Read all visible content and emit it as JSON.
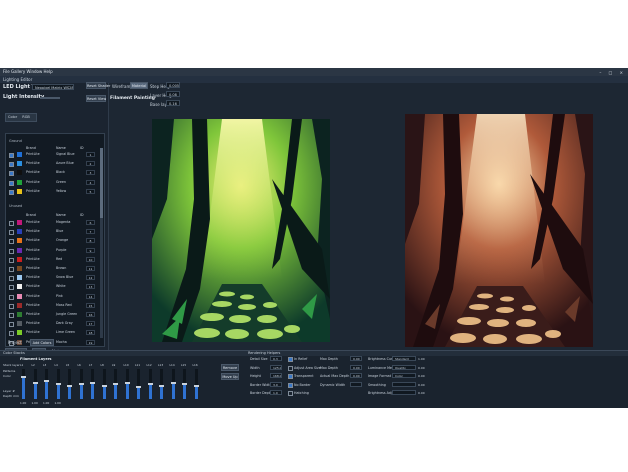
{
  "window": {
    "title": "File  Gallery  Window  Help",
    "controls": "– □ ×"
  },
  "menu": {
    "text": "Lighting Editor"
  },
  "left": {
    "led_type_label": "LED Light Type",
    "led_type_value": "Neopixel Matrix WS2812B",
    "intensity_label": "Light Intensity",
    "tabs": [
      "Color",
      "RGB"
    ],
    "group1": "Ground",
    "col_headers": [
      "Brand",
      "Name",
      "ID"
    ],
    "group1_rows": [
      {
        "brand": "PrintLite",
        "name": "Signal Blue",
        "val": "1",
        "color": "#1f6fd6",
        "checked": true
      },
      {
        "brand": "PrintLite",
        "name": "Azure Blue",
        "val": "2",
        "color": "#2b8fe0",
        "checked": true
      },
      {
        "brand": "PrintLite",
        "name": "Black",
        "val": "3",
        "color": "#101010",
        "checked": true
      },
      {
        "brand": "PrintLite",
        "name": "Green",
        "val": "4",
        "color": "#1fa33a",
        "checked": true
      },
      {
        "brand": "PrintLite",
        "name": "Yellow",
        "val": "5",
        "color": "#e8c21a",
        "checked": true
      }
    ],
    "group2": "Unused",
    "group2_rows": [
      {
        "brand": "PrintLite",
        "name": "Magenta",
        "val": "6",
        "color": "#c2187a"
      },
      {
        "brand": "PrintLite",
        "name": "Blue",
        "val": "7",
        "color": "#2940b8"
      },
      {
        "brand": "PrintLite",
        "name": "Orange",
        "val": "8",
        "color": "#e8731a"
      },
      {
        "brand": "PrintLite",
        "name": "Purple",
        "val": "9",
        "color": "#6a2ab0"
      },
      {
        "brand": "PrintLite",
        "name": "Red",
        "val": "10",
        "color": "#c81e1e"
      },
      {
        "brand": "PrintLite",
        "name": "Brown",
        "val": "11",
        "color": "#7a4a22"
      },
      {
        "brand": "PrintLite",
        "name": "Snow Blue",
        "val": "12",
        "color": "#9cc8f0"
      },
      {
        "brand": "PrintLite",
        "name": "White",
        "val": "13",
        "color": "#f0f0f0"
      },
      {
        "brand": "PrintLite",
        "name": "Pink",
        "val": "14",
        "color": "#e88ab4"
      },
      {
        "brand": "PrintLite",
        "name": "Moss Red",
        "val": "15",
        "color": "#9a2a2a"
      },
      {
        "brand": "PrintLite",
        "name": "Jungle Green",
        "val": "16",
        "color": "#2e7d32"
      },
      {
        "brand": "PrintLite",
        "name": "Dark Gray",
        "val": "17",
        "color": "#555c63"
      },
      {
        "brand": "PrintLite",
        "name": "Lime Green",
        "val": "18",
        "color": "#7ccc28"
      },
      {
        "brand": "PrintLite",
        "name": "Mocha",
        "val": "19",
        "color": "#6b4a3a"
      },
      {
        "brand": "PrintLite",
        "name": "Silver",
        "val": "20",
        "color": "#a8b0b8"
      }
    ],
    "new_btn": "New Element",
    "sort_btn": "Sort",
    "notes_label": "Notes",
    "project_label": "Project",
    "add_btn": "Add Colors"
  },
  "toolbar": {
    "reset_btn": "Reset Shader",
    "mode_label": "Wireframe",
    "mode_btn": "Material",
    "step_label": "Step Height",
    "step_value": "0.005",
    "layer_label": "Layer Height",
    "layer_value": "0.08",
    "base_label": "Base layer",
    "base_value": "0.16",
    "reset_view": "Reset View",
    "title": "Filament Painting"
  },
  "bottom_left": {
    "title": "Color Stacks",
    "header": "Filament Layers",
    "labels": [
      "Stack layer",
      "Patterns",
      "Color"
    ],
    "footer_labels": [
      "Layer #",
      "Depth mm"
    ],
    "columns": [
      "L1",
      "L2",
      "L3",
      "L4",
      "L5",
      "L6",
      "L7",
      "L8",
      "L9",
      "L10",
      "L11",
      "L12",
      "L13",
      "L14",
      "L15",
      "L16"
    ],
    "levels": [
      0.75,
      0.55,
      0.6,
      0.5,
      0.45,
      0.5,
      0.55,
      0.45,
      0.5,
      0.55,
      0.4,
      0.5,
      0.45,
      0.55,
      0.5,
      0.45
    ],
    "bottom_values": [
      "1.00",
      "1.00",
      "1.00",
      "1.00",
      "",
      "",
      "",
      "",
      "",
      "",
      "",
      "",
      "",
      "",
      "",
      ""
    ],
    "btn1": "Remove",
    "btn2": "Move Up"
  },
  "bottom_right": {
    "title": "Rendering Helpers",
    "col1": [
      {
        "label": "Detail Size",
        "value": "0.3"
      },
      {
        "label": "Width",
        "value": "125.00"
      },
      {
        "label": "Height",
        "value": "168.00"
      },
      {
        "label": "Border Width",
        "value": "3.0"
      },
      {
        "label": "Border Depth",
        "value": "1.0"
      }
    ],
    "col2": [
      {
        "label": "In Relief",
        "checked": true
      },
      {
        "label": "Adjust Area Size",
        "checked": false
      },
      {
        "label": "Transparent",
        "checked": true
      },
      {
        "label": "No Border",
        "checked": true
      },
      {
        "label": "Hatching",
        "checked": false
      }
    ],
    "col3": [
      {
        "label": "Max Depth",
        "value": "0.90"
      },
      {
        "label": "Max Depth",
        "value": "0.00"
      },
      {
        "label": "Actual Max Depth",
        "value": "0.00"
      },
      {
        "label": "Dynamic Width",
        "value": ""
      }
    ],
    "col4": [
      {
        "label": "Brightness Curve",
        "value": "Standard"
      },
      {
        "label": "Luminance Method",
        "value": "Quality"
      },
      {
        "label": "Image Format",
        "value": "Color"
      },
      {
        "label": "Smoothing",
        "value": ""
      },
      {
        "label": "Brightness Adjust",
        "value": ""
      }
    ],
    "col4_nums": [
      "1.00",
      "0.00",
      "0.00",
      "0.00",
      "0.00"
    ]
  }
}
